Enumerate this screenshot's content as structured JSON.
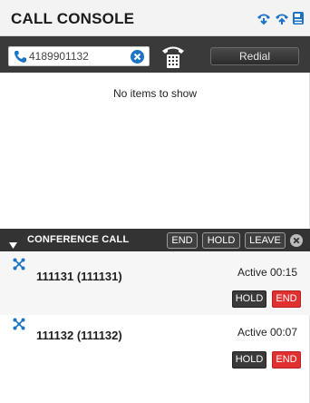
{
  "header": {
    "title": "CALL CONSOLE",
    "icons": [
      "call-transfer-icon",
      "call-forward-icon",
      "voicemail-icon"
    ],
    "accent_color": "#1d74c4"
  },
  "dialer": {
    "number_value": "4189901132",
    "redial_label": "Redial",
    "icons": [
      "phone-icon",
      "clear-icon",
      "dialpad-icon"
    ]
  },
  "call_list": {
    "empty_message": "No items to show"
  },
  "conference": {
    "title": "CONFERENCE CALL",
    "end_label": "END",
    "hold_label": "HOLD",
    "leave_label": "LEAVE",
    "participants": [
      {
        "name": "111131 (111131)",
        "status": "Active 00:15",
        "hold_label": "HOLD",
        "end_label": "END"
      },
      {
        "name": "111132 (111132)",
        "status": "Active 00:07",
        "hold_label": "HOLD",
        "end_label": "END"
      }
    ],
    "end_color": "#e03030"
  }
}
